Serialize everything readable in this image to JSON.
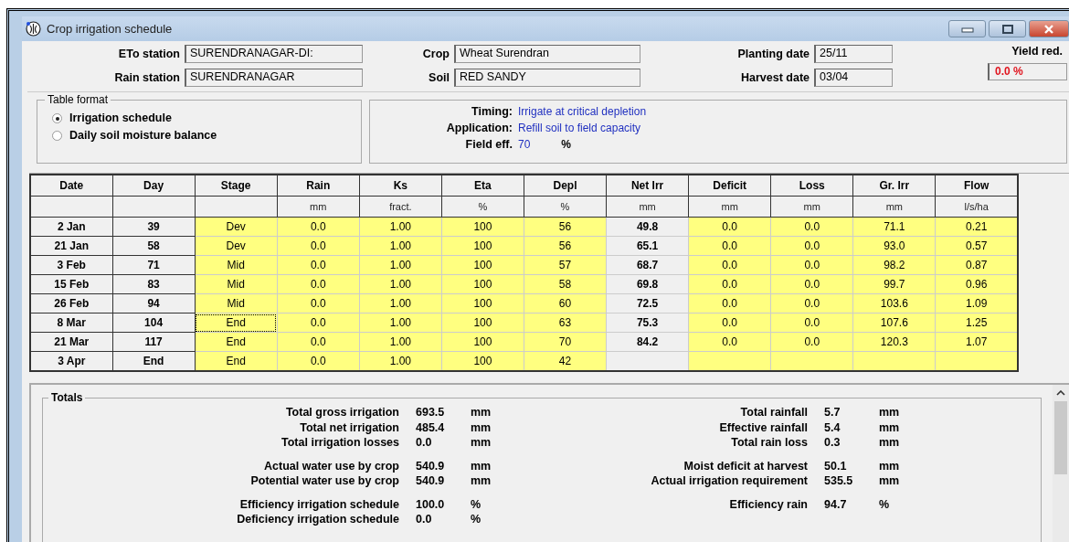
{
  "window": {
    "title": "Crop irrigation schedule"
  },
  "header": {
    "fields": [
      {
        "label": "ETo station",
        "value": "SURENDRANAGAR-DI:"
      },
      {
        "label": "Crop",
        "value": "Wheat Surendran"
      },
      {
        "label": "Planting date",
        "value": "25/11"
      },
      {
        "label": "Rain station",
        "value": "SURENDRANAGAR"
      },
      {
        "label": "Soil",
        "value": "RED SANDY"
      },
      {
        "label": "Harvest date",
        "value": "03/04"
      }
    ],
    "yield": {
      "label": "Yield red.",
      "value": "0.0 %"
    }
  },
  "table_format": {
    "title": "Table format",
    "options": [
      {
        "label": "Irrigation schedule",
        "selected": true
      },
      {
        "label": "Daily soil moisture balance",
        "selected": false
      }
    ]
  },
  "settings": [
    {
      "label": "Timing:",
      "value": "Irrigate at critical depletion"
    },
    {
      "label": "Application:",
      "value": "Refill soil to field capacity"
    },
    {
      "label": "Field eff.",
      "value": "70",
      "unit": "%"
    }
  ],
  "table": {
    "columns": [
      {
        "name": "Date",
        "kind": "key"
      },
      {
        "name": "Day",
        "kind": "key"
      },
      {
        "name": "Stage",
        "kind": "value"
      },
      {
        "name": "Rain",
        "unit": "mm",
        "kind": "value"
      },
      {
        "name": "Ks",
        "unit": "fract.",
        "kind": "value"
      },
      {
        "name": "Eta",
        "unit": "%",
        "kind": "value"
      },
      {
        "name": "Depl",
        "unit": "%",
        "kind": "value"
      },
      {
        "name": "Net Irr",
        "unit": "mm",
        "kind": "result"
      },
      {
        "name": "Deficit",
        "unit": "mm",
        "kind": "value"
      },
      {
        "name": "Loss",
        "unit": "mm",
        "kind": "value"
      },
      {
        "name": "Gr. Irr",
        "unit": "mm",
        "kind": "value"
      },
      {
        "name": "Flow",
        "unit": "l/s/ha",
        "kind": "value"
      }
    ],
    "rows": [
      {
        "stage_focused": false,
        "cells": [
          "2 Jan",
          "39",
          "Dev",
          "0.0",
          "1.00",
          "100",
          "56",
          "49.8",
          "0.0",
          "0.0",
          "71.1",
          "0.21"
        ]
      },
      {
        "stage_focused": false,
        "cells": [
          "21 Jan",
          "58",
          "Dev",
          "0.0",
          "1.00",
          "100",
          "56",
          "65.1",
          "0.0",
          "0.0",
          "93.0",
          "0.57"
        ]
      },
      {
        "stage_focused": false,
        "cells": [
          "3 Feb",
          "71",
          "Mid",
          "0.0",
          "1.00",
          "100",
          "57",
          "68.7",
          "0.0",
          "0.0",
          "98.2",
          "0.87"
        ]
      },
      {
        "stage_focused": false,
        "cells": [
          "15 Feb",
          "83",
          "Mid",
          "0.0",
          "1.00",
          "100",
          "58",
          "69.8",
          "0.0",
          "0.0",
          "99.7",
          "0.96"
        ]
      },
      {
        "stage_focused": false,
        "cells": [
          "26 Feb",
          "94",
          "Mid",
          "0.0",
          "1.00",
          "100",
          "60",
          "72.5",
          "0.0",
          "0.0",
          "103.6",
          "1.09"
        ]
      },
      {
        "stage_focused": true,
        "cells": [
          "8 Mar",
          "104",
          "End",
          "0.0",
          "1.00",
          "100",
          "63",
          "75.3",
          "0.0",
          "0.0",
          "107.6",
          "1.25"
        ]
      },
      {
        "stage_focused": false,
        "cells": [
          "21 Mar",
          "117",
          "End",
          "0.0",
          "1.00",
          "100",
          "70",
          "84.2",
          "0.0",
          "0.0",
          "120.3",
          "1.07"
        ]
      },
      {
        "stage_focused": false,
        "cells": [
          "3 Apr",
          "End",
          "End",
          "0.0",
          "1.00",
          "100",
          "42",
          "",
          "",
          "",
          "",
          ""
        ]
      }
    ]
  },
  "totals": {
    "title": "Totals",
    "left": [
      [
        {
          "label": "Total gross irrigation",
          "value": "693.5",
          "unit": "mm"
        },
        {
          "label": "Total net irrigation",
          "value": "485.4",
          "unit": "mm"
        },
        {
          "label": "Total irrigation losses",
          "value": "0.0",
          "unit": "mm"
        }
      ],
      [
        {
          "label": "Actual water use by crop",
          "value": "540.9",
          "unit": "mm"
        },
        {
          "label": "Potential water use by crop",
          "value": "540.9",
          "unit": "mm"
        }
      ],
      [
        {
          "label": "Efficiency irrigation schedule",
          "value": "100.0",
          "unit": "%"
        },
        {
          "label": "Deficiency irrigation schedule",
          "value": "0.0",
          "unit": "%"
        }
      ]
    ],
    "right": [
      [
        {
          "label": "Total rainfall",
          "value": "5.7",
          "unit": "mm"
        },
        {
          "label": "Effective rainfall",
          "value": "5.4",
          "unit": "mm"
        },
        {
          "label": "Total rain loss",
          "value": "0.3",
          "unit": "mm"
        }
      ],
      [
        {
          "label": "Moist deficit at harvest",
          "value": "50.1",
          "unit": "mm"
        },
        {
          "label": "Actual irrigation requirement",
          "value": "535.5",
          "unit": "mm"
        }
      ],
      [
        {
          "label": "Efficiency rain",
          "value": "94.7",
          "unit": "%"
        }
      ]
    ]
  }
}
